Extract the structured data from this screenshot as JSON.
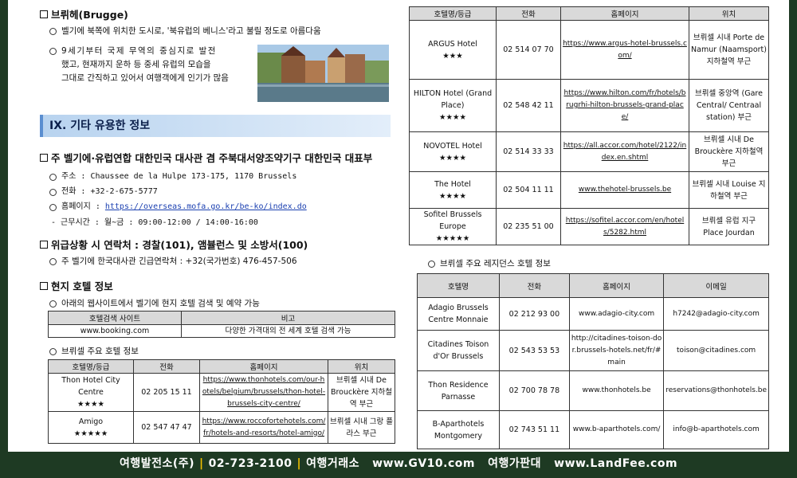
{
  "brugge": {
    "heading": "브뤼헤(Brugge)",
    "p1": "벨기에 북쪽에 위치한 도시로, '북유럽의 베니스'라고 불릴 정도로 아름다움",
    "p2a": "9세기부터 국제 무역의 중심지로 발전",
    "p2b": "했고, 현재까지 운하 등 중세 유럽의 모습을",
    "p2c": "그대로 간직하고 있어서 여행객에게 인기가 많음"
  },
  "section": {
    "title": "IX. 기타 유용한 정보"
  },
  "embassy": {
    "heading": "주 벨기에·유럽연합 대한민국 대사관 겸 주북대서양조약기구 대한민국 대표부",
    "address": "주소 : Chaussee de la Hulpe 173-175, 1170 Brussels",
    "phone": "전화 : +32-2-675-5777",
    "web_label": "홈페이지 : ",
    "web_url": "https://overseas.mofa.go.kr/be-ko/index.do",
    "hours": "- 근무시간 : 월~금 : 09:00-12:00 / 14:00-16:00"
  },
  "emergency": {
    "heading": "위급상황 시 연락처 : 경찰(101), 앰뷸런스 및 소방서(100)",
    "line": "주 벨기에 한국대사관 긴급연락처 : +32(국가번호) 476-457-506"
  },
  "hotels": {
    "heading": "현지 호텔 정보",
    "intro": "아래의 웹사이트에서 벨기에 현지 호텔 검색 및 예약 가능",
    "search_table": {
      "headers": [
        "호텔검색 사이트",
        "비고"
      ],
      "row": [
        "www.booking.com",
        "다양한 가격대의 전 세계 호텔 검색 가능"
      ]
    },
    "main_label": "브뤼셀 주요 호텔 정보",
    "main_headers": [
      "호텔명/등급",
      "전화",
      "홈페이지",
      "위치"
    ],
    "main_rows_left": [
      {
        "name": "Thon Hotel City Centre",
        "stars": "★★★★",
        "phone": "02 205 15 11",
        "url": "https://www.thonhotels.com/our-hotels/belgium/brussels/thon-hotel-brussels-city-centre/",
        "loc": "브뤼셀 시내 De Brouckère 지하철역 부근"
      },
      {
        "name": "Amigo",
        "stars": "★★★★★",
        "phone": "02 547 47 47",
        "url": "https://www.roccofortehotels.com/fr/hotels-and-resorts/hotel-amigo/",
        "loc": "브뤼셀 시내 그랑 플라스 부근"
      }
    ],
    "main_rows_right": [
      {
        "name": "ARGUS Hotel",
        "stars": "★★★",
        "phone": "02 514 07 70",
        "url": "https://www.argus-hotel-brussels.com/",
        "loc": "브뤼셀 시내 Porte de Namur (Naamsport) 지하철역 부근"
      },
      {
        "name": "HILTON Hotel (Grand Place)",
        "stars": "★★★★",
        "phone": "02 548 42 11",
        "url": "https://www.hilton.com/fr/hotels/brugrhi-hilton-brussels-grand-place/",
        "loc": "브뤼셀 중앙역 (Gare Central/ Centraal station) 부근"
      },
      {
        "name": "NOVOTEL Hotel",
        "stars": "★★★★",
        "phone": "02 514 33 33",
        "url": "https://all.accor.com/hotel/2122/index.en.shtml",
        "loc": "브뤼셀 시내 De Brouckère 지하철역 부근"
      },
      {
        "name": "The Hotel",
        "stars": "★★★★",
        "phone": "02 504 11 11",
        "url": "www.thehotel-brussels.be",
        "loc": "브뤼셀 시내 Louise 지하철역 부근"
      },
      {
        "name": "Sofitel Brussels Europe",
        "stars": "★★★★★",
        "phone": "02 235 51 00",
        "url": "https://sofitel.accor.com/en/hotels/5282.html",
        "loc": "브뤼셀 유럽 지구 Place Jourdan"
      }
    ],
    "residence_label": "브뤼셀 주요 레지던스 호텔 정보",
    "residence_headers": [
      "호텔명",
      "전화",
      "홈페이지",
      "이메일"
    ],
    "residence_rows": [
      {
        "name": "Adagio Brussels Centre Monnaie",
        "phone": "02 212 93 00",
        "url": "www.adagio-city.com",
        "email": "h7242@adagio-city.com"
      },
      {
        "name": "Citadines Toison d'Or Brussels",
        "phone": "02 543 53 53",
        "url": "http://citadines-toison-dor.brussels-hotels.net/fr/#main",
        "email": "toison@citadines.com"
      },
      {
        "name": "Thon Residence Parnasse",
        "phone": "02 700 78 78",
        "url": "www.thonhotels.be",
        "email": "reservations@thonhotels.be"
      },
      {
        "name": "B-Aparthotels Montgomery",
        "phone": "02 743 51 11",
        "url": "www.b-aparthotels.com/",
        "email": "info@b-aparthotels.com"
      }
    ]
  },
  "footer": {
    "company": "여행발전소(주)",
    "phone": "02-723-2100",
    "site1_label": "여행거래소",
    "site1": "www.GV10.com",
    "site2_label": "여행가판대",
    "site2": "www.LandFee.com"
  },
  "colors": {
    "frame": "#1e3a23",
    "section_bar": "#b8d3ef",
    "separator": "#f3c100"
  }
}
